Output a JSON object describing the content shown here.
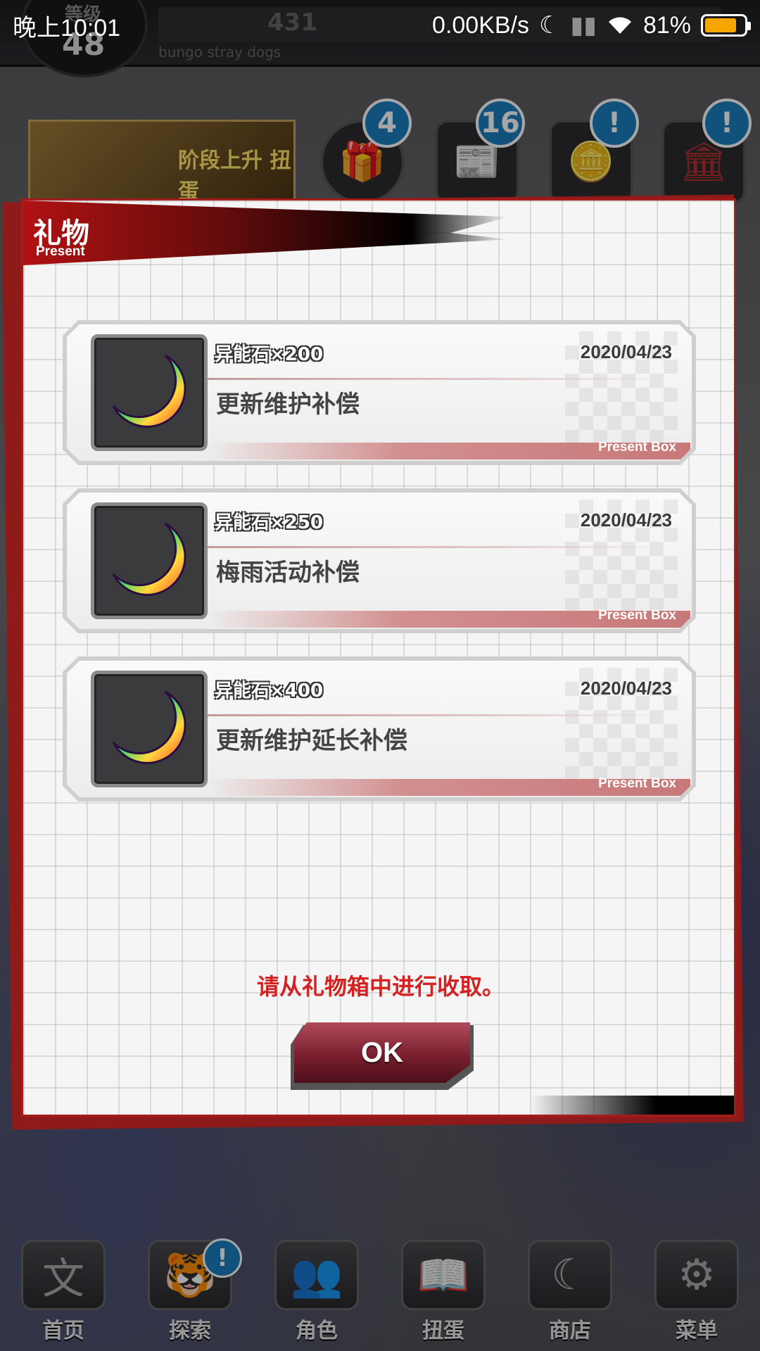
{
  "status_bar": {
    "time": "晚上10:01",
    "network_speed": "0.00KB/s",
    "battery": "81%",
    "battery_level": 0.81,
    "battery_color": "#f7a600"
  },
  "background": {
    "level_label": "等级",
    "level_value": "48",
    "currency_value": "431",
    "subtitle": "bungo stray dogs",
    "banner_text": "阶段上升 扭蛋",
    "icons": [
      {
        "name": "gift-icon",
        "badge": "4"
      },
      {
        "name": "news-icon",
        "badge": "16"
      },
      {
        "name": "coin-touch-icon",
        "badge": "!"
      },
      {
        "name": "building-icon",
        "badge": "!"
      }
    ],
    "nav": [
      {
        "label": "首页",
        "icon": "home-icon",
        "badge": ""
      },
      {
        "label": "探索",
        "icon": "explore-icon",
        "badge": "!"
      },
      {
        "label": "角色",
        "icon": "characters-icon",
        "badge": ""
      },
      {
        "label": "扭蛋",
        "icon": "gacha-icon",
        "badge": ""
      },
      {
        "label": "商店",
        "icon": "shop-icon",
        "badge": ""
      },
      {
        "label": "菜单",
        "icon": "gear-icon",
        "badge": ""
      }
    ]
  },
  "dialog": {
    "title": "礼物",
    "subtitle": "Present",
    "accent_color": "#a51c1c",
    "items": [
      {
        "name": "异能石×200",
        "date": "2020/04/23",
        "description": "更新维护补偿",
        "footer": "Present Box",
        "icon": "crescent-gem-icon"
      },
      {
        "name": "异能石×250",
        "date": "2020/04/23",
        "description": "梅雨活动补偿",
        "footer": "Present Box",
        "icon": "crescent-gem-icon"
      },
      {
        "name": "异能石×400",
        "date": "2020/04/23",
        "description": "更新维护延长补偿",
        "footer": "Present Box",
        "icon": "crescent-gem-icon"
      }
    ],
    "notice": "请从礼物箱中进行收取。",
    "notice_color": "#d42121",
    "ok_label": "OK"
  }
}
